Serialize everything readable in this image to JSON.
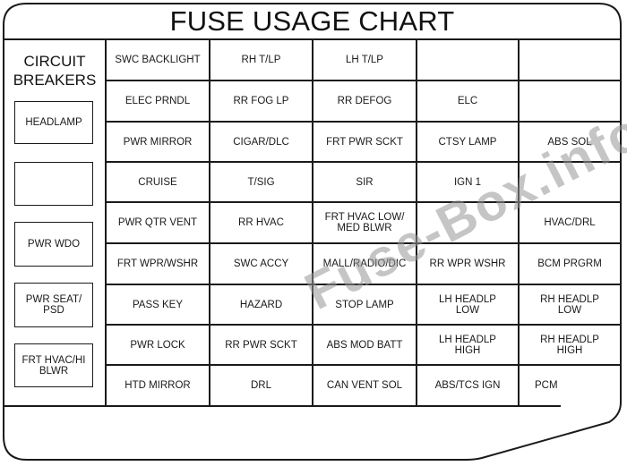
{
  "title": "FUSE USAGE CHART",
  "circuit_breakers": {
    "heading": "CIRCUIT\nBREAKERS",
    "items": [
      {
        "label": "HEADLAMP"
      },
      {
        "label": ""
      },
      {
        "label": "PWR WDO"
      },
      {
        "label": "PWR SEAT/\nPSD"
      },
      {
        "label": "FRT HVAC/HI\nBLWR"
      }
    ]
  },
  "fuses": {
    "rows": [
      [
        "SWC BACKLIGHT",
        "RH T/LP",
        "LH T/LP",
        "",
        ""
      ],
      [
        "ELEC PRNDL",
        "RR FOG LP",
        "RR DEFOG",
        "ELC",
        ""
      ],
      [
        "PWR MIRROR",
        "CIGAR/DLC",
        "FRT PWR SCKT",
        "CTSY LAMP",
        "ABS SOL"
      ],
      [
        "CRUISE",
        "T/SIG",
        "SIR",
        "IGN 1",
        ""
      ],
      [
        "PWR QTR VENT",
        "RR HVAC",
        "FRT HVAC LOW/\nMED BLWR",
        "",
        "HVAC/DRL"
      ],
      [
        "FRT WPR/WSHR",
        "SWC ACCY",
        "MALL/RADIO/DIC",
        "RR WPR WSHR",
        "BCM PRGRM"
      ],
      [
        "PASS KEY",
        "HAZARD",
        "STOP LAMP",
        "LH HEADLP\nLOW",
        "RH HEADLP\nLOW"
      ],
      [
        "PWR LOCK",
        "RR PWR SCKT",
        "ABS MOD BATT",
        "LH HEADLP\nHIGH",
        "RH HEADLP\nHIGH"
      ],
      [
        "HTD MIRROR",
        "DRL",
        "CAN VENT SOL",
        "ABS/TCS IGN",
        "PCM"
      ]
    ]
  },
  "watermark": "Fuse-Box.info"
}
